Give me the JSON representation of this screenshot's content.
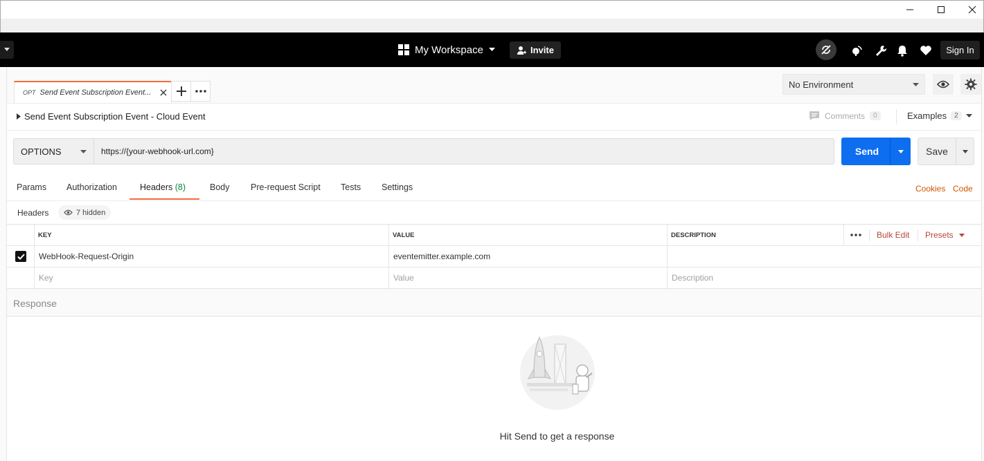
{
  "window": {
    "minimize_icon": "minimize-icon",
    "maximize_icon": "maximize-icon",
    "close_icon": "close-icon"
  },
  "appbar": {
    "workspace_label": "My Workspace",
    "invite_label": "Invite",
    "signin_label": "Sign In"
  },
  "tabs": {
    "active": {
      "method": "OPT",
      "name": "Send Event Subscription Event..."
    }
  },
  "environment": {
    "selected": "No Environment"
  },
  "request": {
    "title": "Send Event Subscription Event - Cloud Event",
    "comments_label": "Comments",
    "comments_count": "0",
    "examples_label": "Examples",
    "examples_count": "2",
    "method": "OPTIONS",
    "url": "https://{your-webhook-url.com}",
    "send_label": "Send",
    "save_label": "Save"
  },
  "subtabs": {
    "params": "Params",
    "authorization": "Authorization",
    "headers": "Headers",
    "headers_count": "(8)",
    "body": "Body",
    "prerequest": "Pre-request Script",
    "tests": "Tests",
    "settings": "Settings",
    "cookies": "Cookies",
    "code": "Code"
  },
  "headers_bar": {
    "label": "Headers",
    "hidden_label": "7 hidden"
  },
  "table": {
    "columns": {
      "key": "KEY",
      "value": "VALUE",
      "description": "DESCRIPTION"
    },
    "bulk_edit": "Bulk Edit",
    "presets": "Presets",
    "rows": [
      {
        "checked": true,
        "key": "WebHook-Request-Origin",
        "value": "eventemitter.example.com",
        "description": ""
      }
    ],
    "placeholders": {
      "key": "Key",
      "value": "Value",
      "description": "Description"
    }
  },
  "response": {
    "label": "Response",
    "hint": "Hit Send to get a response"
  },
  "colors": {
    "accent": "#f26b3a",
    "send": "#0d6ef0",
    "link": "#d35400"
  }
}
